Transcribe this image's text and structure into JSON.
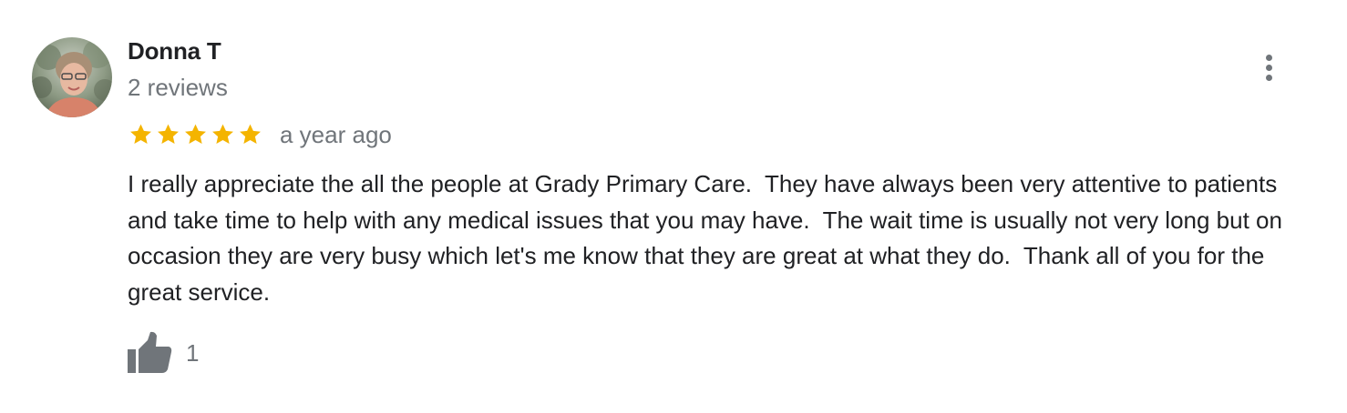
{
  "review": {
    "reviewer": {
      "name": "Donna T",
      "review_count": "2 reviews",
      "avatar_icon": "user-photo-avatar"
    },
    "rating": {
      "stars": 5,
      "max_stars": 5,
      "star_color": "#f4b400"
    },
    "date": "a year ago",
    "text": "I really appreciate the all the people at Grady Primary Care.  They have always been very attentive to patients and take time to help with any medical issues that you may have.  The wait time is usually not very long but on occasion they are very busy which let's me know that they are great at what they do.  Thank all of you for the great service.",
    "actions": {
      "more_icon": "more-vert-icon",
      "like_icon": "thumbs-up-icon",
      "like_count": "1"
    }
  },
  "colors": {
    "primary_text": "#202124",
    "secondary_text": "#70757a",
    "icon": "#70757a"
  }
}
